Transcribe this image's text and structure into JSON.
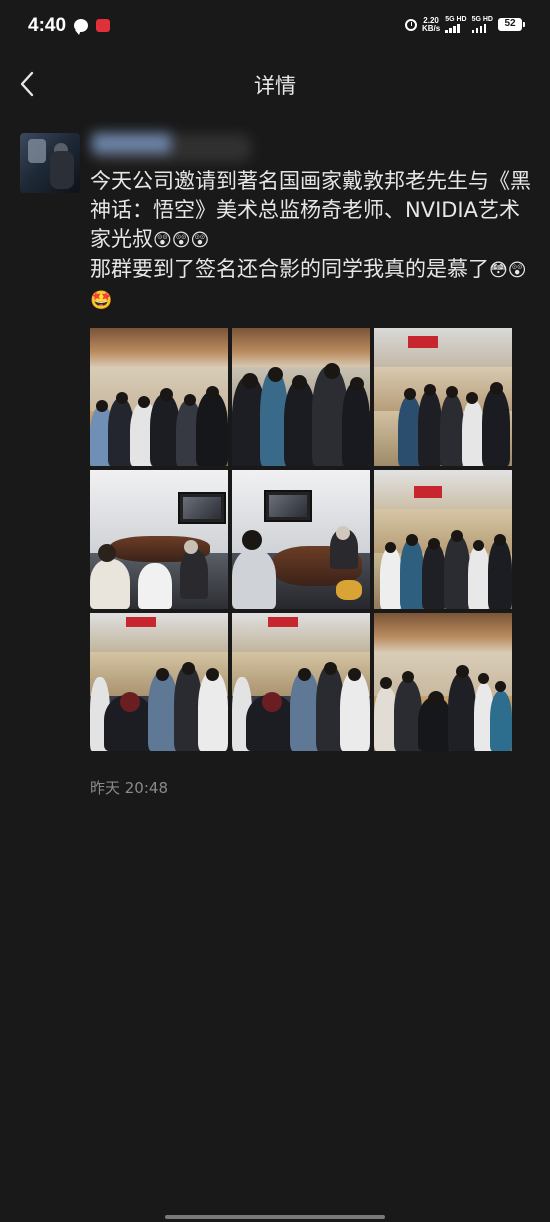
{
  "status_bar": {
    "time": "4:40",
    "net_speed_value": "2.20",
    "net_speed_unit": "KB/s",
    "sim1_label": "5G HD",
    "sim2_label": "5G HD",
    "battery": "52"
  },
  "nav": {
    "title": "详情"
  },
  "post": {
    "username": "██████",
    "text_line1": "今天公司邀请到著名国画家戴敦邦老先生与《黑神话：悟空》美术总监杨奇老师、NVIDIA艺术家光叔",
    "text_emoji1": "😲😲😲",
    "text_line2": "那群要到了签名还合影的同学我真的是慕了",
    "text_emoji2": "😳",
    "text_emoji3": "😲🤩",
    "photos": [
      {
        "name": "photo-1"
      },
      {
        "name": "photo-2"
      },
      {
        "name": "photo-3"
      },
      {
        "name": "photo-4"
      },
      {
        "name": "photo-5"
      },
      {
        "name": "photo-6"
      },
      {
        "name": "photo-7"
      },
      {
        "name": "photo-8"
      },
      {
        "name": "photo-9"
      }
    ],
    "timestamp": "昨天 20:48"
  }
}
